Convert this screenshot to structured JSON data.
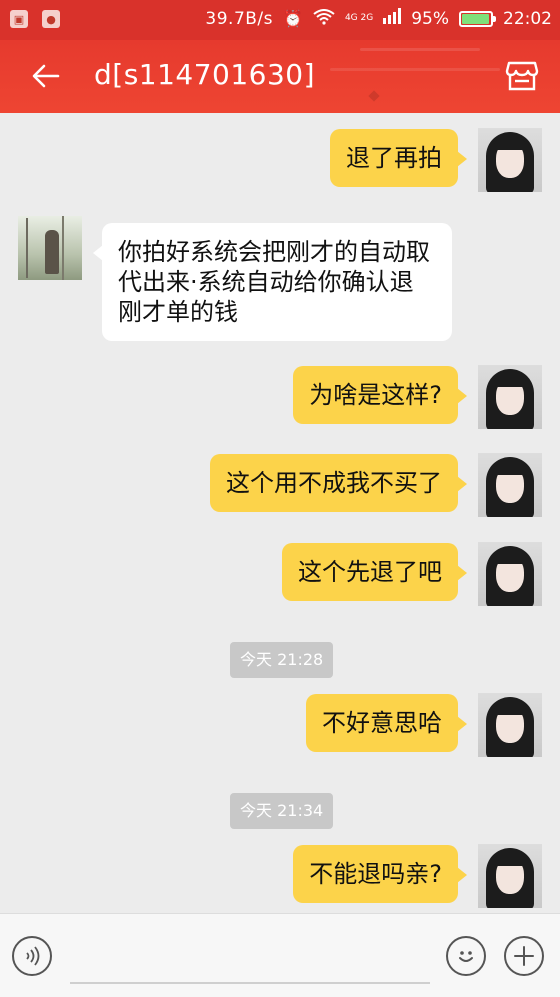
{
  "status_bar": {
    "network_speed": "39.7B/s",
    "network_type": "4G 2G",
    "battery": "95%",
    "battery_level": 0.95,
    "time": "22:02",
    "icons": [
      "notification-icon",
      "qq-icon",
      "alarm-icon",
      "wifi-icon",
      "signal-icon",
      "battery-icon"
    ]
  },
  "header": {
    "title": "d[s114701630]",
    "back_icon": "back-arrow-icon",
    "shop_icon": "shop-icon"
  },
  "messages": [
    {
      "sender": "me",
      "text": "退了再拍"
    },
    {
      "sender": "other",
      "text": "你拍好系统会把刚才的自动取代出来·系统自动给你确认退刚才单的钱"
    },
    {
      "sender": "me",
      "text": "为啥是这样?"
    },
    {
      "sender": "me",
      "text": "这个用不成我不买了"
    },
    {
      "sender": "me",
      "text": "这个先退了吧"
    },
    {
      "type": "timestamp",
      "text": "今天 21:28"
    },
    {
      "sender": "me",
      "text": "不好意思哈"
    },
    {
      "type": "timestamp",
      "text": "今天 21:34"
    },
    {
      "sender": "me",
      "text": "不能退吗亲?"
    }
  ],
  "input_bar": {
    "voice_icon": "voice-icon",
    "emoji_icon": "emoji-icon",
    "plus_icon": "plus-icon"
  },
  "colors": {
    "header": "#e63a2e",
    "bubble_me": "#fcd34a",
    "bubble_other": "#ffffff",
    "background": "#ececec"
  }
}
